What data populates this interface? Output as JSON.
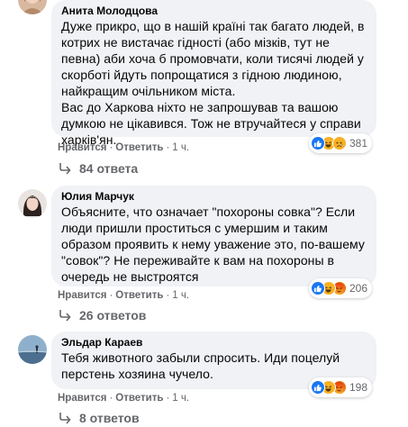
{
  "comments": [
    {
      "author": "Анита Молодцова",
      "paragraphs": [
        "Дуже прикро, що в нашій країні так багато людей, в котрих не вистачає гідності (або мізків, тут не певна) аби хоча б промовчати, коли тисячі людей у скорботі йдуть попрощатися з гідною людиною, найкращим очільником міста.",
        "Вас до Харкова ніхто не запрошував та вашою думкою не цікавився. Тож не втручайтеся у справи харків'ян."
      ],
      "like_label": "Нравится",
      "reply_label": "Ответить",
      "time": "1 ч.",
      "reactions": [
        "like-icon",
        "haha-icon",
        "sad-icon"
      ],
      "reaction_count": "381",
      "replies_label": "84 ответа"
    },
    {
      "author": "Юлия Марчук",
      "paragraphs": [
        "Объясните, что означает \"похороны совка\"? Если люди пришли проститься с умершим и таким образом проявить к нему уважение это, по-вашему \"совок\"? Не переживайте к вам на похороны в очередь не выстроятся"
      ],
      "like_label": "Нравится",
      "reply_label": "Ответить",
      "time": "1 ч.",
      "reactions": [
        "like-icon",
        "haha-icon",
        "angry-icon"
      ],
      "reaction_count": "206",
      "replies_label": "26 ответов"
    },
    {
      "author": "Эльдар Караев",
      "paragraphs": [
        "Тебя животного забыли спросить. Иди поцелуй перстень хозяина чучело."
      ],
      "like_label": "Нравится",
      "reply_label": "Ответить",
      "time": "1 ч.",
      "reactions": [
        "like-icon",
        "haha-icon",
        "angry-icon"
      ],
      "reaction_count": "198",
      "replies_label": "8 ответов"
    }
  ],
  "separator": "·",
  "colors": {
    "like": "#1877f2",
    "haha": "#f7b125",
    "angry": "#e9710f",
    "bubble": "#f0f2f5",
    "meta": "#65676b"
  }
}
